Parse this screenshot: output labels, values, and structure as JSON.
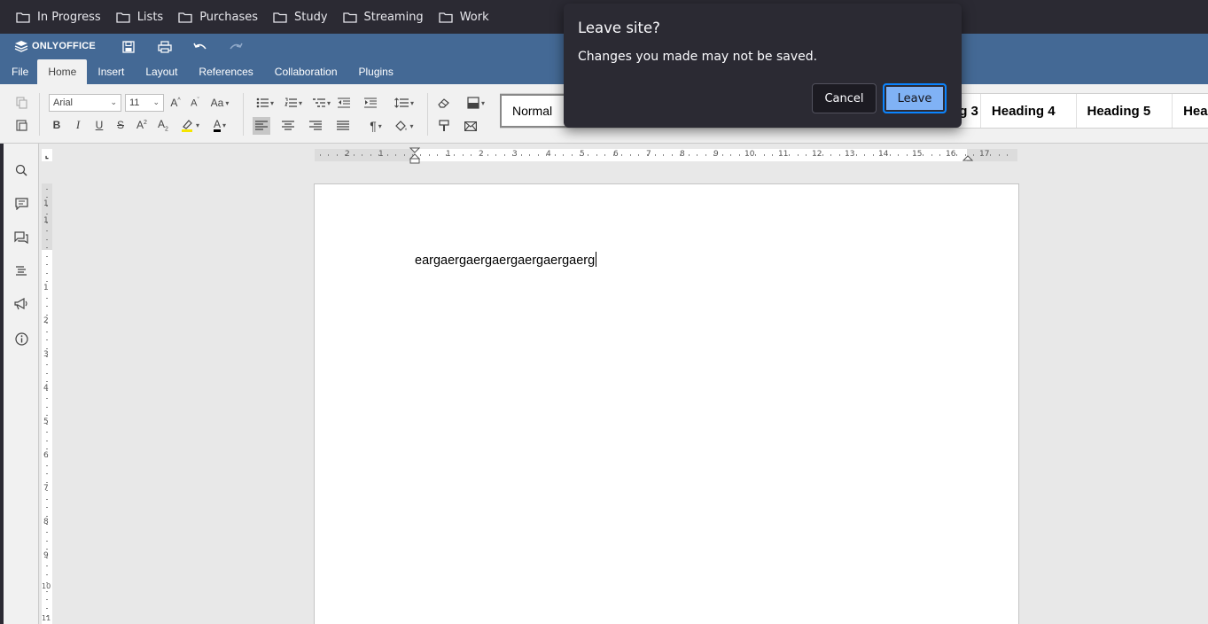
{
  "bookmarks": [
    "In Progress",
    "Lists",
    "Purchases",
    "Study",
    "Streaming",
    "Work"
  ],
  "app": {
    "logo": "ONLYOFFICE",
    "tabs": [
      "File",
      "Home",
      "Insert",
      "Layout",
      "References",
      "Collaboration",
      "Plugins"
    ],
    "active_tab": "Home"
  },
  "toolbar": {
    "font_name": "Arial",
    "font_size": "11",
    "styles": [
      "Normal",
      "Heading 3",
      "Heading 4",
      "Heading 5",
      "Hea"
    ]
  },
  "ruler": {
    "h_numbers": [
      "2",
      "1",
      "1",
      "2",
      "3",
      "4",
      "5",
      "6",
      "7",
      "8",
      "9",
      "10",
      "11",
      "12",
      "13",
      "14",
      "15",
      "16",
      "17"
    ],
    "v_numbers": [
      "1",
      "1",
      "1",
      "2",
      "3",
      "4",
      "5",
      "6",
      "7",
      "8",
      "9",
      "10",
      "11"
    ]
  },
  "document": {
    "text": "eargaergaergaergaergaergaerg"
  },
  "dialog": {
    "title": "Leave site?",
    "message": "Changes you made may not be saved.",
    "cancel": "Cancel",
    "leave": "Leave"
  },
  "colors": {
    "header": "#446995",
    "bookmarks_bar": "#2b2a33",
    "dialog_bg": "#2b2a33",
    "leave_button": "#80b2f5"
  }
}
